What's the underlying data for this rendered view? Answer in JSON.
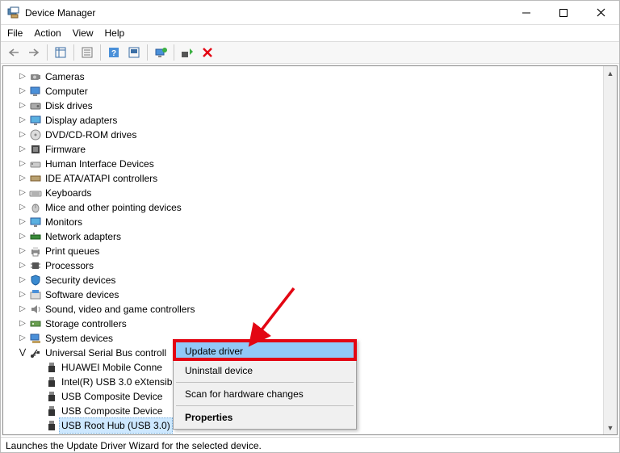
{
  "window": {
    "title": "Device Manager"
  },
  "menu": {
    "file": "File",
    "action": "Action",
    "view": "View",
    "help": "Help"
  },
  "tree": {
    "cameras": "Cameras",
    "computer": "Computer",
    "disk": "Disk drives",
    "display": "Display adapters",
    "dvd": "DVD/CD-ROM drives",
    "firmware": "Firmware",
    "hid": "Human Interface Devices",
    "ide": "IDE ATA/ATAPI controllers",
    "keyboards": "Keyboards",
    "mice": "Mice and other pointing devices",
    "monitors": "Monitors",
    "network": "Network adapters",
    "printq": "Print queues",
    "processors": "Processors",
    "security": "Security devices",
    "software": "Software devices",
    "sound": "Sound, video and game controllers",
    "storage": "Storage controllers",
    "system": "System devices",
    "usb": "Universal Serial Bus controll",
    "usb_children": {
      "huawei": "HUAWEI Mobile Conne",
      "intel": "Intel(R) USB 3.0 eXtensib",
      "comp1": "USB Composite Device",
      "comp2": "USB Composite Device",
      "roothub": "USB Root Hub (USB 3.0)"
    }
  },
  "context_menu": {
    "update": "Update driver",
    "uninstall": "Uninstall device",
    "scan": "Scan for hardware changes",
    "properties": "Properties"
  },
  "statusbar": "Launches the Update Driver Wizard for the selected device."
}
